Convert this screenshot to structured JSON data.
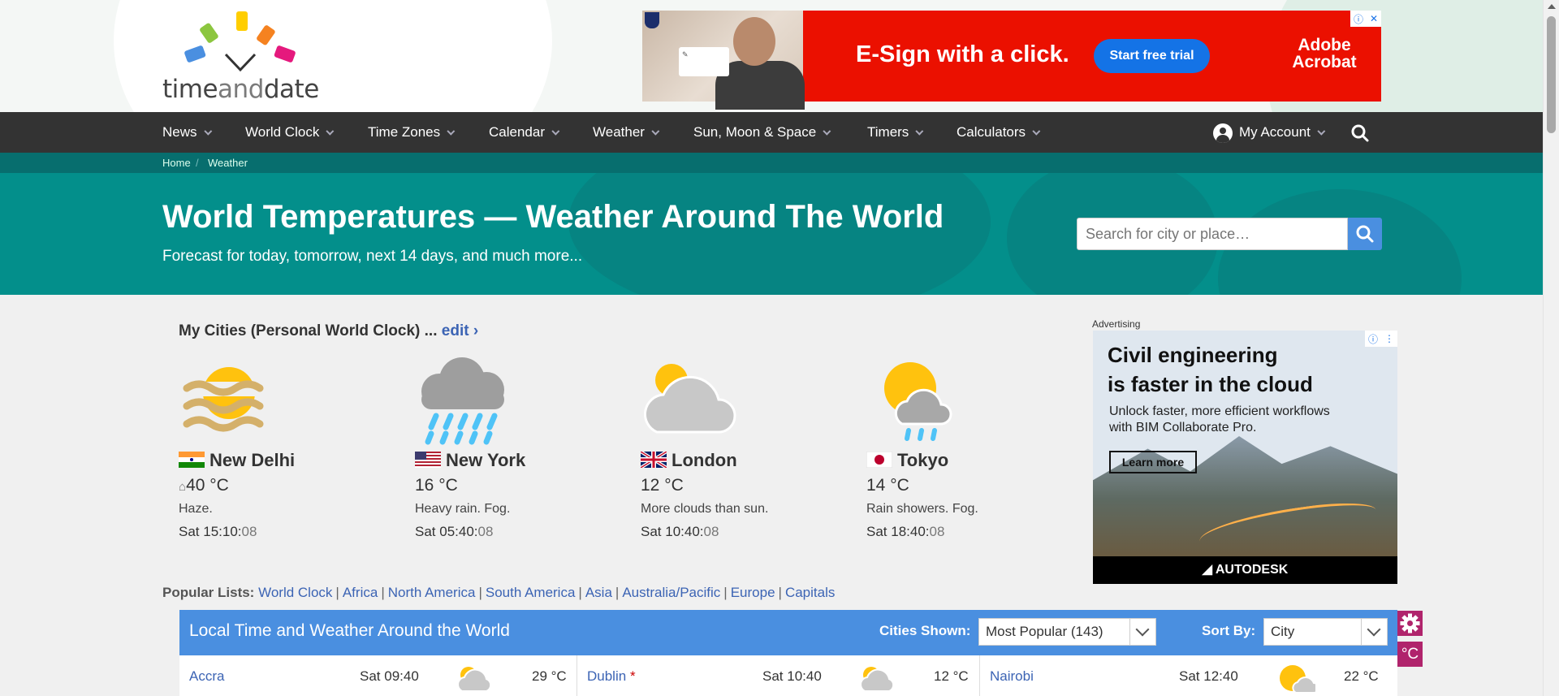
{
  "header": {
    "logo_text_1": "time",
    "logo_text_2": "and",
    "logo_text_3": "date"
  },
  "top_ad": {
    "headline": "E-Sign with a click.",
    "cta": "Start free trial",
    "brand": "Adobe Acrobat"
  },
  "nav": {
    "items": [
      "News",
      "World Clock",
      "Time Zones",
      "Calendar",
      "Weather",
      "Sun, Moon & Space",
      "Timers",
      "Calculators"
    ],
    "account": "My Account"
  },
  "breadcrumb": {
    "home": "Home",
    "current": "Weather",
    "sep": "/"
  },
  "hero": {
    "title": "World Temperatures — Weather Around The World",
    "subtitle": "Forecast for today, tomorrow, next 14 days, and much more...",
    "search_placeholder": "Search for city or place…"
  },
  "my_cities": {
    "title": "My Cities (Personal World Clock) ...",
    "edit": "edit ›",
    "cities": [
      {
        "name": "New Delhi",
        "temp": "40 °C",
        "desc": "Haze.",
        "time": "Sat 15:10:",
        "sec": "08",
        "icon": "haze-icon",
        "flag": "india-flag"
      },
      {
        "name": "New York",
        "temp": "16 °C",
        "desc": "Heavy rain. Fog.",
        "time": "Sat 05:40:",
        "sec": "08",
        "icon": "heavy-rain-icon",
        "flag": "usa-flag"
      },
      {
        "name": "London",
        "temp": "12 °C",
        "desc": "More clouds than sun.",
        "time": "Sat 10:40:",
        "sec": "08",
        "icon": "mostly-cloudy-icon",
        "flag": "uk-flag"
      },
      {
        "name": "Tokyo",
        "temp": "14 °C",
        "desc": "Rain showers. Fog.",
        "time": "Sat 18:40:",
        "sec": "08",
        "icon": "rain-showers-icon",
        "flag": "japan-flag"
      }
    ]
  },
  "side_ad": {
    "label": "Advertising",
    "headline_1": "Civil engineering",
    "headline_2": "is faster in the cloud",
    "body_1": "Unlock faster, more efficient workflows",
    "body_2": "with BIM Collaborate Pro.",
    "cta": "Learn more",
    "brand": "AUTODESK"
  },
  "popular": {
    "label": "Popular Lists:",
    "links": [
      "World Clock",
      "Africa",
      "North America",
      "South America",
      "Asia",
      "Australia/Pacific",
      "Europe",
      "Capitals"
    ]
  },
  "table": {
    "title": "Local Time and Weather Around the World",
    "cities_shown_label": "Cities Shown:",
    "cities_shown_value": "Most Popular (143)",
    "sort_by_label": "Sort By:",
    "sort_by_value": "City",
    "unit_button": "°C",
    "rows": [
      [
        {
          "city": "Accra",
          "dst": "",
          "time": "Sat 09:40",
          "temp": "29 °C",
          "icon": "partly-cloudy-icon"
        },
        {
          "city": "Dublin",
          "dst": "*",
          "time": "Sat 10:40",
          "temp": "12 °C",
          "icon": "partly-cloudy-icon"
        },
        {
          "city": "Nairobi",
          "dst": "",
          "time": "Sat 12:40",
          "temp": "22 °C",
          "icon": "sun-cloud-icon"
        }
      ]
    ]
  },
  "colors": {
    "nav_bg": "#333333",
    "hero_bg": "#038f8b",
    "table_head": "#4a8fe0",
    "link": "#3c64b4",
    "accent_magenta": "#b0246c"
  }
}
